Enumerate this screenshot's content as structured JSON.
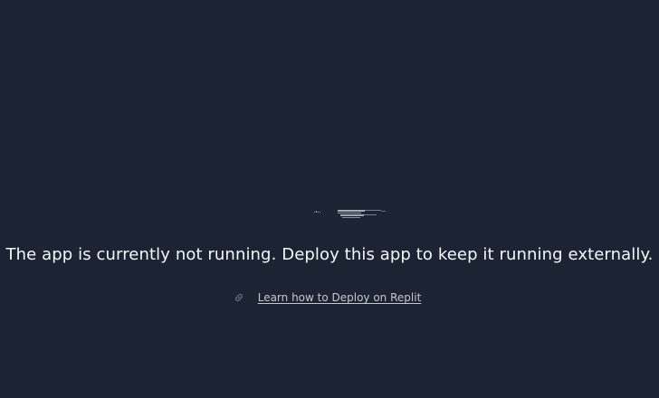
{
  "message": "The app is currently not running. Deploy this app to keep it running externally.",
  "learn_link": {
    "label": "Learn how to Deploy on Replit",
    "icon": "link-icon"
  },
  "colors": {
    "background": "#1c2333",
    "text": "#f5f9fc",
    "link": "#c2c8cc"
  }
}
